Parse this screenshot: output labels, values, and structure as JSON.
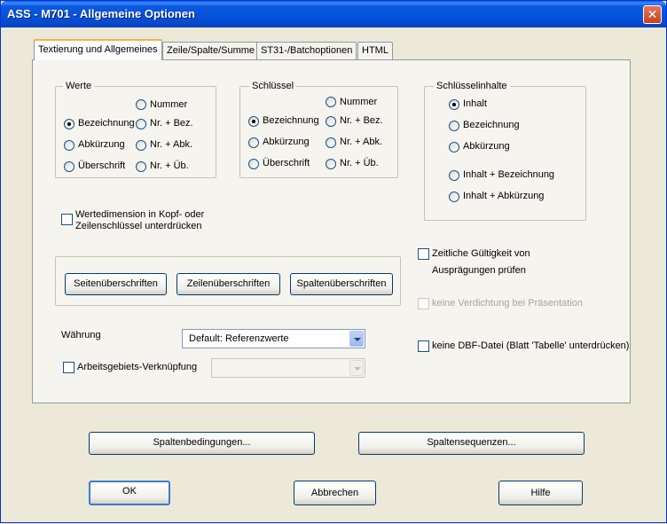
{
  "window": {
    "title": "ASS - M701 - Allgemeine Optionen",
    "close": "✕"
  },
  "tabs": [
    {
      "label": "Textierung und Allgemeines",
      "active": true
    },
    {
      "label": "Zeile/Spalte/Summe"
    },
    {
      "label": "ST31-/Batchoptionen"
    },
    {
      "label": "HTML"
    }
  ],
  "werte": {
    "label": "Werte",
    "options": [
      "Nummer",
      "Bezeichnung",
      "Nr. + Bez.",
      "Abkürzung",
      "Nr. + Abk.",
      "Überschrift",
      "Nr. + Üb."
    ],
    "selected": "Bezeichnung"
  },
  "schluessel": {
    "label": "Schlüssel",
    "options": [
      "Nummer",
      "Bezeichnung",
      "Nr. + Bez.",
      "Abkürzung",
      "Nr. + Abk.",
      "Überschrift",
      "Nr. + Üb."
    ],
    "selected": "Bezeichnung"
  },
  "schluesselinhalte": {
    "label": "Schlüsselinhalte",
    "options": [
      "Inhalt",
      "Bezeichnung",
      "Abkürzung",
      "Inhalt + Bezeichnung",
      "Inhalt + Abkürzung"
    ],
    "selected": "Inhalt"
  },
  "wertedimension": {
    "line1": "Wertedimension in Kopf- oder",
    "line2": "Zeilenschlüssel unterdrücken",
    "checked": false
  },
  "headings_buttons": [
    "Seitenüberschriften",
    "Zeilenüberschriften",
    "Spaltenüberschriften"
  ],
  "zeitliche": {
    "line1": "Zeitliche Gültigkeit von",
    "line2": "Ausprägungen prüfen",
    "checked": false
  },
  "verdichtung": {
    "label": "keine Verdichtung bei Präsentation",
    "checked": false,
    "disabled": true
  },
  "waehrung": {
    "label": "Währung",
    "value": "Default: Referenzwerte"
  },
  "arbeitsgebiet": {
    "label": "Arbeitsgebiets-Verknüpfung",
    "checked": false,
    "value": ""
  },
  "dbf": {
    "label": "keine DBF-Datei (Blatt 'Tabelle' unterdrücken)",
    "checked": false
  },
  "bottom_buttons": {
    "spaltenbedingungen": "Spaltenbedingungen...",
    "spaltensequenzen": "Spaltensequenzen..."
  },
  "dialog_buttons": {
    "ok": "OK",
    "cancel": "Abbrechen",
    "help": "Hilfe"
  }
}
